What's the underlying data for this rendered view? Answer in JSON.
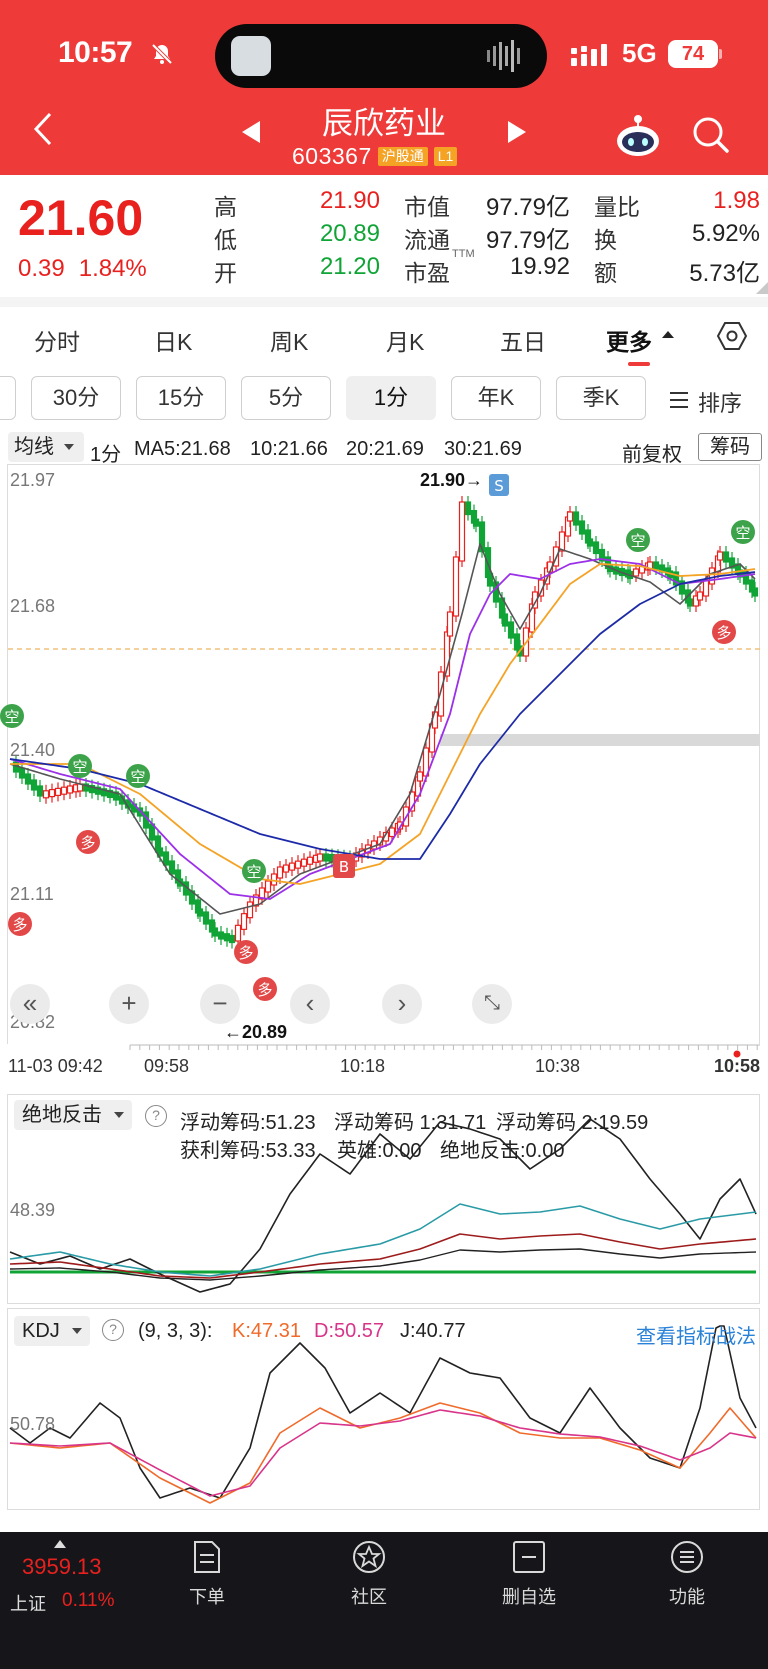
{
  "status_bar": {
    "time": "10:57",
    "network": "5G",
    "battery": "74"
  },
  "header": {
    "stock_name": "辰欣药业",
    "stock_code": "603367",
    "tags": [
      "沪股通",
      "L1"
    ]
  },
  "quote": {
    "price": "21.60",
    "change": "0.39",
    "change_pct": "1.84%",
    "stats": [
      {
        "label": "高",
        "value": "21.90",
        "color": "#e8211f"
      },
      {
        "label": "低",
        "value": "20.89",
        "color": "#10a436"
      },
      {
        "label": "开",
        "value": "21.20",
        "color": "#10a436"
      },
      {
        "label": "市值",
        "value": "97.79亿",
        "color": "#222222"
      },
      {
        "label": "流通",
        "value": "97.79亿",
        "color": "#222222"
      },
      {
        "label": "市盈",
        "value": "19.92",
        "color": "#222222"
      },
      {
        "label": "量比",
        "value": "1.98",
        "color": "#e8211f"
      },
      {
        "label": "换",
        "value": "5.92%",
        "color": "#222222"
      },
      {
        "label": "额",
        "value": "5.73亿",
        "color": "#222222"
      }
    ],
    "pe_superscript": "TTM"
  },
  "tabs": [
    "分时",
    "日K",
    "周K",
    "月K",
    "五日",
    "更多"
  ],
  "periods": [
    "30分",
    "15分",
    "5分",
    "1分",
    "年K",
    "季K"
  ],
  "active_period": "1分",
  "sort_label": "排序",
  "ma_bar": {
    "selector": "均线",
    "items": [
      {
        "text": "1分",
        "color": "#f4a325"
      },
      {
        "text": "MA5:21.68",
        "color": "#444444"
      },
      {
        "text": "10:21.66",
        "color": "#9b30e8"
      },
      {
        "text": "20:21.69",
        "color": "#f4a325"
      },
      {
        "text": "30:21.69",
        "color": "#1d2aa8"
      }
    ],
    "fuquan": "前复权",
    "chips": "筹码"
  },
  "main_chart": {
    "y_labels": [
      "21.97",
      "21.68",
      "21.40",
      "21.11",
      "20.82"
    ],
    "high_marker": "21.90→",
    "low_marker": "←20.89",
    "signal_s": "S",
    "signal_b": "B",
    "kong": "空",
    "duo": "多",
    "controls": [
      "«",
      "+",
      "−",
      "‹",
      "›",
      "⤡"
    ]
  },
  "time_axis": [
    "11-03 09:42",
    "09:58",
    "10:18",
    "10:38",
    "10:58"
  ],
  "indicator1": {
    "selector": "绝地反击",
    "level": "48.39",
    "texts": [
      {
        "text": "浮动筹码:51.23",
        "color": "#2a9ba6"
      },
      {
        "text": "浮动筹码 1:31.71",
        "color": "#9e1b1b"
      },
      {
        "text": "浮动筹码 2:19.59",
        "color": "#222222"
      },
      {
        "text": "获利筹码:53.33",
        "color": "#222222"
      },
      {
        "text": "英雄:0.00",
        "color": "#e8211f"
      },
      {
        "text": "绝地反击:0.00",
        "color": "#10a436"
      }
    ]
  },
  "kdj": {
    "selector": "KDJ",
    "params": "(9, 3, 3):",
    "k": "K:47.31",
    "d": "D:50.57",
    "j": "J:40.77",
    "level": "50.78",
    "link": "查看指标战法"
  },
  "bottom": {
    "index_value": "3959.13",
    "index_name": "上证",
    "index_pct": "0.11%",
    "nav": [
      "下单",
      "社区",
      "删自选",
      "功能"
    ]
  }
}
